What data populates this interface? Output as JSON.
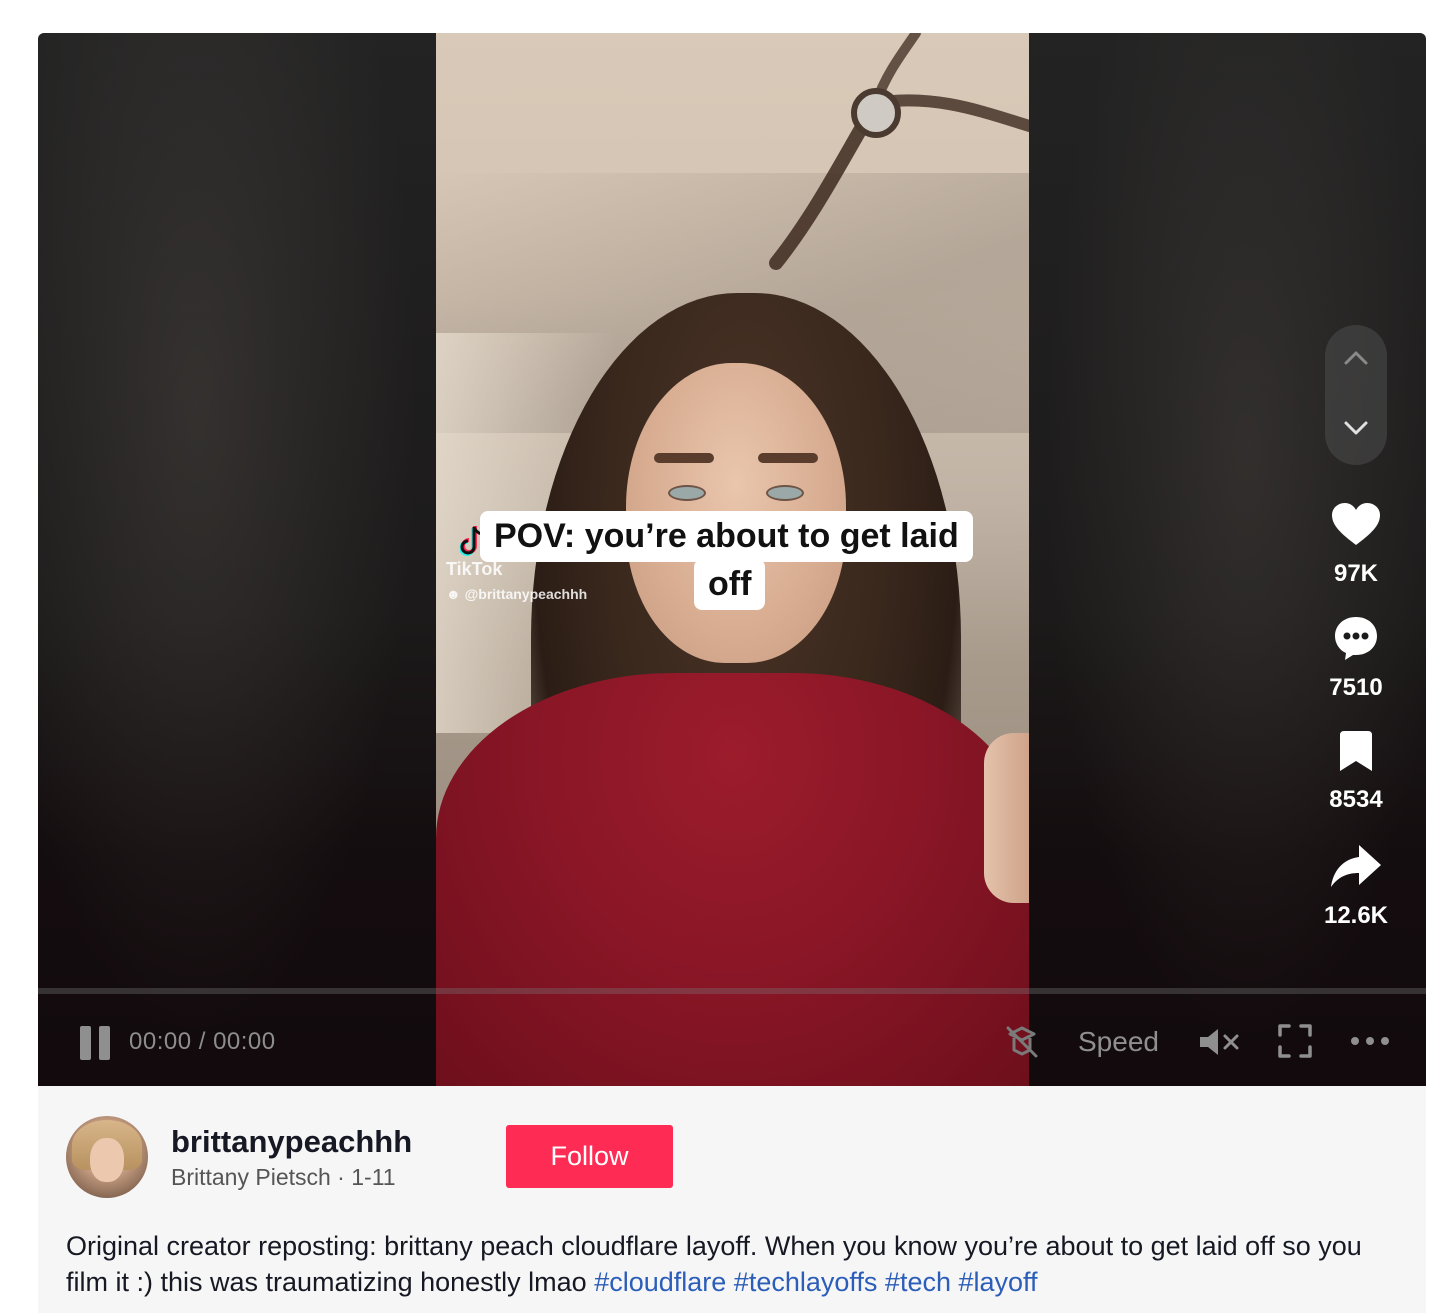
{
  "video": {
    "watermark_brand": "TikTok",
    "watermark_user": "@brittanypeachhh",
    "caption_line1": "POV: you’re about to get laid",
    "caption_line2": "off"
  },
  "player_controls": {
    "time": "00:00 / 00:00",
    "speed_label": "Speed",
    "progress": 0
  },
  "actions": {
    "likes": "97K",
    "comments": "7510",
    "saves": "8534",
    "shares": "12.6K"
  },
  "post": {
    "username": "brittanypeachhh",
    "display_name": "Brittany Pietsch",
    "separator": " · ",
    "date": "1-11",
    "follow_label": "Follow",
    "description": "Original creator reposting: brittany peach cloudflare layoff. When you know you’re about to get laid off so you film it :) this was traumatizing honestly lmao ",
    "hashtags": [
      "#cloudflare",
      "#techlayoffs",
      "#tech",
      "#layoff"
    ]
  },
  "colors": {
    "follow_button": "#fe2c55",
    "hashtag": "#2b5db9",
    "panel_background": "#f6f6f6"
  },
  "icons": [
    "pause-icon",
    "no-stream-icon",
    "mute-icon",
    "fullscreen-icon",
    "more-icon",
    "chevron-up-icon",
    "chevron-down-icon",
    "heart-icon",
    "comment-icon",
    "bookmark-icon",
    "share-icon",
    "tiktok-logo-icon"
  ]
}
